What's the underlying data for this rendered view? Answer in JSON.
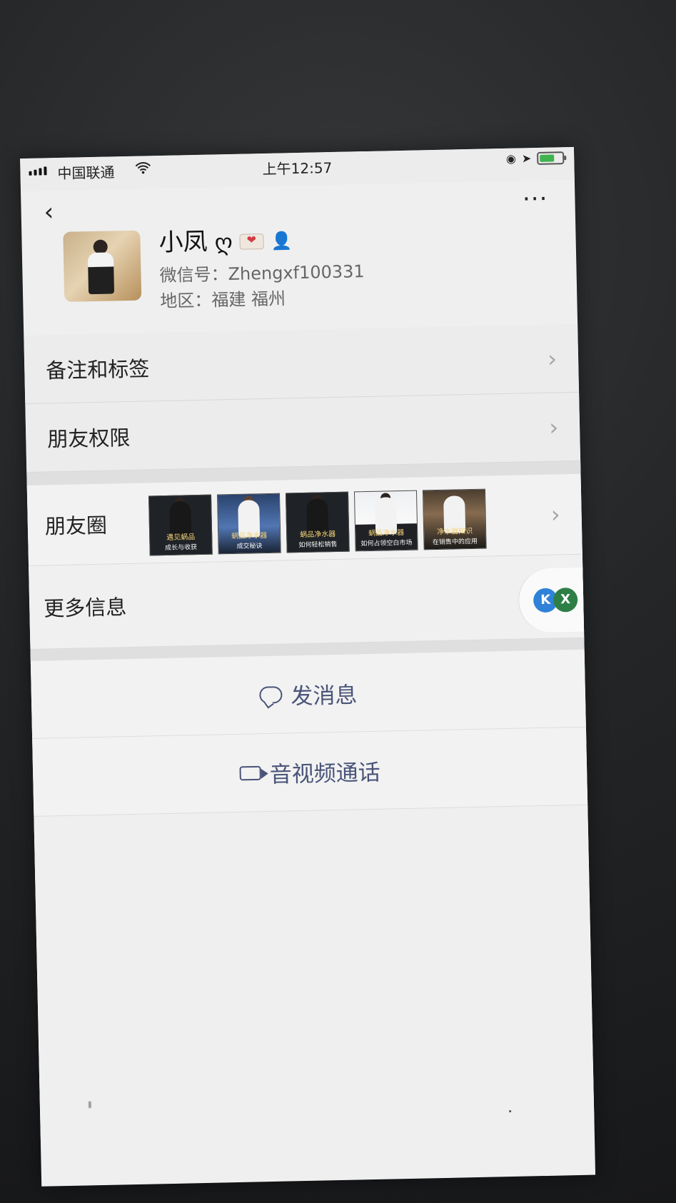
{
  "status_bar": {
    "carrier": "中国联通",
    "time": "上午12:57",
    "battery_percent": 65,
    "battery_color": "#40b34f"
  },
  "nav": {
    "back_icon": "back-icon",
    "more_icon": "more-icon"
  },
  "profile": {
    "name": "小凤",
    "name_suffix": "ღ",
    "wechat_id_label": "微信号：Zhengxf100331",
    "region_label": "地区：福建 福州"
  },
  "menu": {
    "items": [
      {
        "label": "备注和标签"
      },
      {
        "label": "朋友权限"
      }
    ]
  },
  "moments": {
    "label": "朋友圈",
    "thumbs": [
      {
        "line1": "遇见蜗品",
        "line2": "成长与收获"
      },
      {
        "line1": "蜗品净水器",
        "line2": "成交秘诀"
      },
      {
        "line1": "蜗品净水器",
        "line2": "如何轻松销售"
      },
      {
        "line1": "蜗品净水器",
        "line2": "如何占领空白市场"
      },
      {
        "line1": "净水器知识",
        "line2": "在销售中的应用"
      }
    ]
  },
  "more_info": {
    "label": "更多信息"
  },
  "actions": {
    "message": "发消息",
    "video_call": "音视频通话"
  },
  "floating": {
    "k_label": "K",
    "x_label": "X"
  },
  "colors": {
    "link_text": "#4a5479",
    "chevron": "#a5a5a5"
  }
}
